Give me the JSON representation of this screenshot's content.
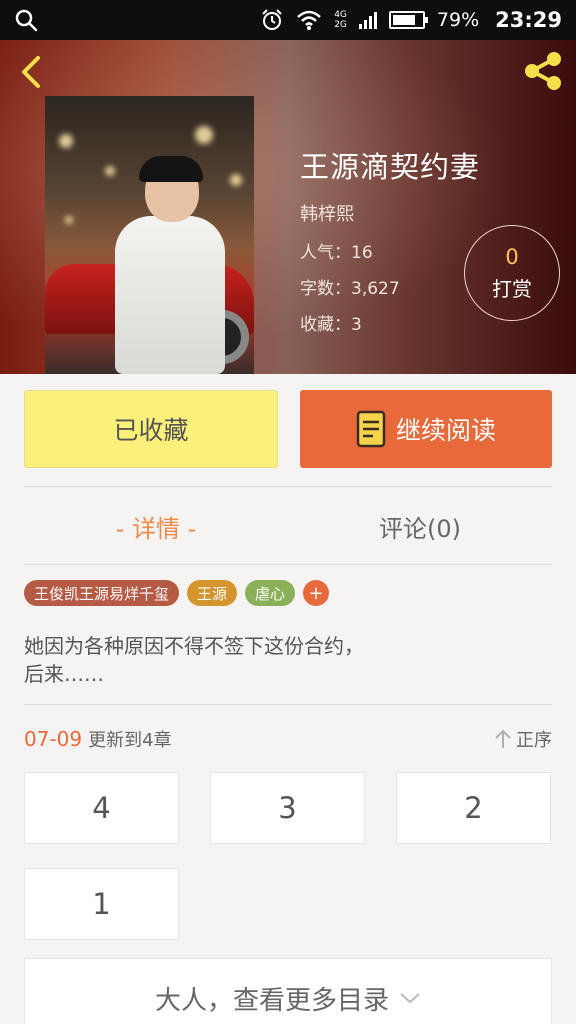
{
  "status_bar": {
    "net_top": "4G",
    "net_bottom": "2G",
    "battery_percent": "79%",
    "battery_level": 0.79,
    "time": "23:29"
  },
  "book": {
    "title": "王源滴契约妻",
    "author": "韩梓熙",
    "popularity": "人气：16",
    "word_count": "字数：3,627",
    "favorites": "收藏：3",
    "tip_count": "0",
    "tip_label": "打赏"
  },
  "actions": {
    "favorite_label": "已收藏",
    "read_label": "继续阅读"
  },
  "tabs": [
    {
      "label": "- 详情 -"
    },
    {
      "label": "评论(0)"
    }
  ],
  "tags": [
    {
      "label": "王俊凯王源易烊千玺",
      "color": "#b55a45"
    },
    {
      "label": "王源",
      "color": "#d4952f"
    },
    {
      "label": "虐心",
      "color": "#8bb05a"
    }
  ],
  "tag_add": "+",
  "summary": {
    "line1": "她因为各种原因不得不签下这份合约，",
    "line2": "后来……"
  },
  "update": {
    "date": "07-09",
    "text": "更新到4章",
    "order": "正序"
  },
  "chapters": [
    "4",
    "3",
    "2",
    "1"
  ],
  "more_label": "大人，查看更多目录",
  "colors": {
    "accent": "#e8693a",
    "fav_button": "#fbf07a",
    "tab_active": "#ef8a4a"
  }
}
